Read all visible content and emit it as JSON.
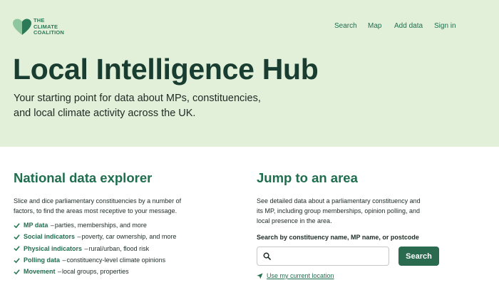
{
  "brand": {
    "logo_line1": "THE",
    "logo_line2": "CLIMATE",
    "logo_line3": "COALITION",
    "color": "#2a7a57"
  },
  "nav": {
    "search": "Search",
    "map": "Map",
    "add_data": "Add data",
    "sign_in": "Sign in"
  },
  "hero": {
    "title": "Local Intelligence Hub",
    "subtitle": "Your starting point for data about MPs, constituencies, and local climate activity across the UK.",
    "background": "#e2efd9"
  },
  "explorer": {
    "heading": "National data explorer",
    "description": "Slice and dice parliamentary constituencies by a number of factors, to find the areas most receptive to your message.",
    "features": [
      {
        "label": "MP data",
        "detail": "parties, memberships, and more"
      },
      {
        "label": "Social indicators",
        "detail": "poverty, car ownership, and more"
      },
      {
        "label": "Physical indicators",
        "detail": "rural/urban, flood risk"
      },
      {
        "label": "Polling data",
        "detail": "constituency-level climate opinions"
      },
      {
        "label": "Movement",
        "detail": "local groups, properties"
      }
    ]
  },
  "jump": {
    "heading": "Jump to an area",
    "description": "See detailed data about a parliamentary constituency and its MP, including group memberships, opinion polling, and local presence in the area.",
    "search_label": "Search by constituency name, MP name, or postcode",
    "search_value": "",
    "search_placeholder": "",
    "button": "Search",
    "location_link": "Use my current location"
  },
  "colors": {
    "accent": "#1f6e4e",
    "button": "#2a6b4f",
    "title": "#193d30"
  },
  "icons": {
    "logo": "heart-logo-icon",
    "check": "check-icon",
    "search": "search-icon",
    "location": "location-arrow-icon"
  }
}
